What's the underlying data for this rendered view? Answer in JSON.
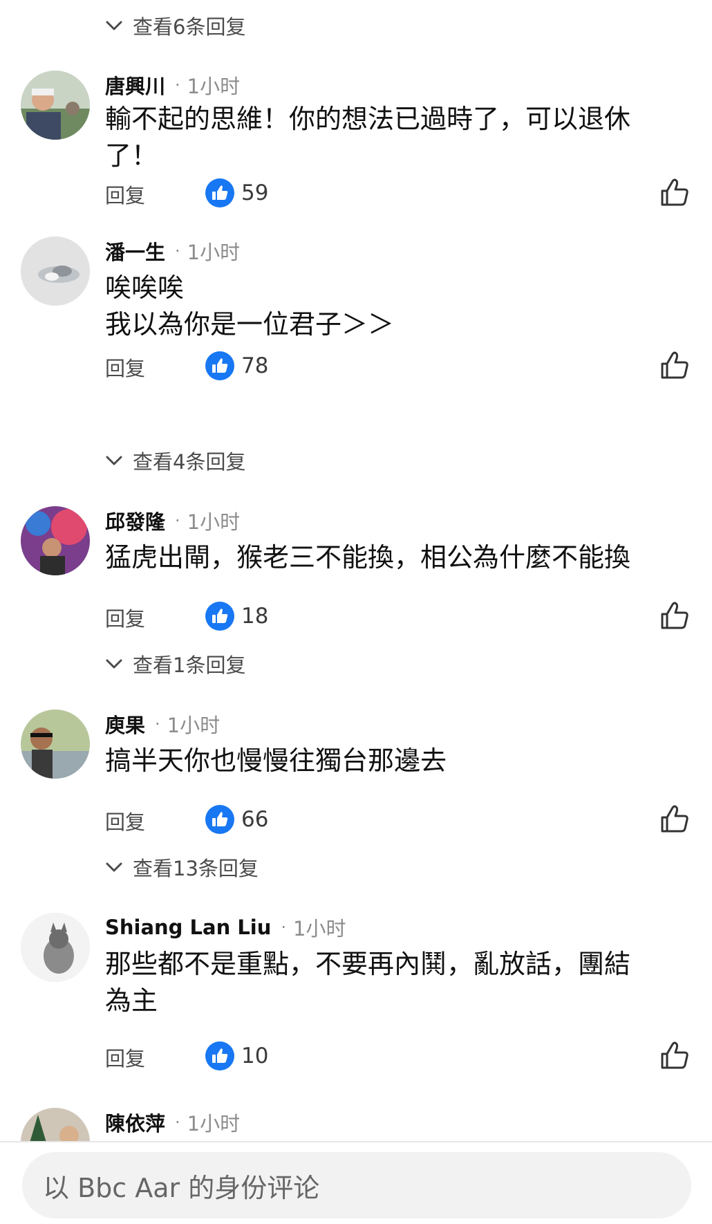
{
  "view_replies": [
    {
      "label": "查看6条回复"
    },
    {
      "label": "查看4条回复"
    },
    {
      "label": "查看1条回复"
    },
    {
      "label": "查看13条回复"
    }
  ],
  "comments": [
    {
      "name": "唐興川",
      "time": "1小时",
      "lines": [
        "輸不起的思維！你的想法已過時了，可以退休",
        "了！"
      ],
      "reply_label": "回复",
      "likes": "59"
    },
    {
      "name": "潘一生",
      "time": "1小时",
      "lines": [
        "唉唉唉",
        "我以為你是一位君子＞＞"
      ],
      "reply_label": "回复",
      "likes": "78"
    },
    {
      "name": "邱發隆",
      "time": "1小时",
      "lines": [
        "猛虎出閘，猴老三不能換，相公為什麼不能換"
      ],
      "reply_label": "回复",
      "likes": "18"
    },
    {
      "name": "庾果",
      "time": "1小时",
      "lines": [
        "搞半天你也慢慢往獨台那邊去"
      ],
      "reply_label": "回复",
      "likes": "66"
    },
    {
      "name": "Shiang Lan Liu",
      "time": "1小时",
      "lines": [
        "那些都不是重點，不要再內鬨，亂放話，團結",
        "為主"
      ],
      "reply_label": "回复",
      "likes": "10"
    },
    {
      "name": "陳依萍",
      "time": "1小时"
    }
  ],
  "dot": "·",
  "comment_input": {
    "placeholder": "以 Bbc Aar 的身份评论"
  },
  "colors": {
    "like_blue": "#1877f2",
    "text": "#111111",
    "muted": "#8c8c8c"
  },
  "icons": {
    "thumb_filled": "thumbs-up-filled-icon",
    "thumb_outline": "thumbs-up-outline-icon",
    "chevron": "chevron-down-icon"
  }
}
